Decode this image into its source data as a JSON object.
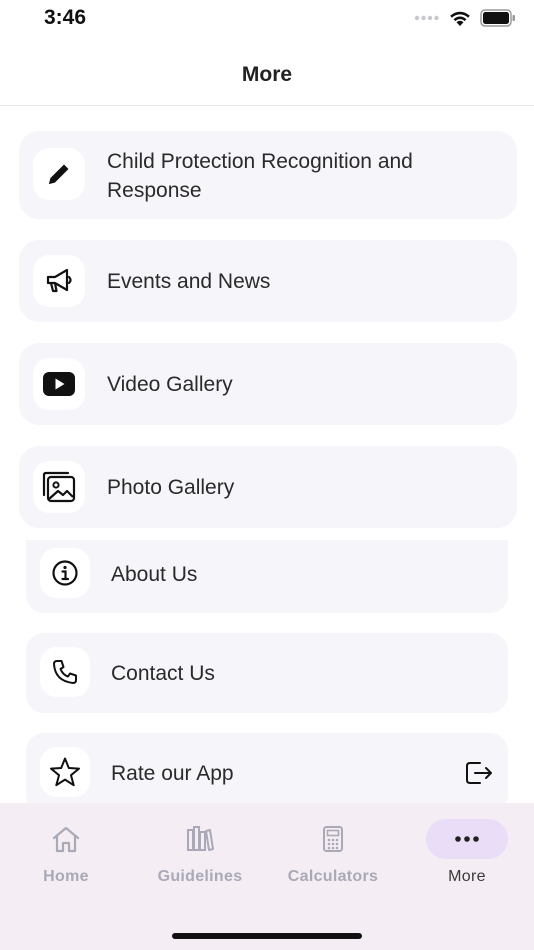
{
  "status_bar": {
    "time": "3:46"
  },
  "header": {
    "title": "More"
  },
  "menu": {
    "items": [
      {
        "label": "Child Protection Recognition and Response",
        "icon": "pencil-icon"
      },
      {
        "label": "Events and News",
        "icon": "megaphone-icon"
      },
      {
        "label": "Video Gallery",
        "icon": "youtube-icon"
      },
      {
        "label": "Photo Gallery",
        "icon": "photo-gallery-icon"
      },
      {
        "label": "About Us",
        "icon": "info-icon"
      },
      {
        "label": "Contact Us",
        "icon": "phone-icon"
      },
      {
        "label": "Rate our App",
        "icon": "star-icon",
        "trailing_icon": "external-link-icon"
      }
    ]
  },
  "tab_bar": {
    "tabs": [
      {
        "label": "Home",
        "icon": "home-icon",
        "active": false
      },
      {
        "label": "Guidelines",
        "icon": "books-icon",
        "active": false
      },
      {
        "label": "Calculators",
        "icon": "calculator-icon",
        "active": false
      },
      {
        "label": "More",
        "icon": "more-dots-icon",
        "active": true
      }
    ]
  },
  "colors": {
    "card_background": "#f5f5fa",
    "tab_bar_background": "#f4edf3",
    "active_tab_pill": "#e9ddf7",
    "inactive_tab": "#a9a9b8"
  }
}
